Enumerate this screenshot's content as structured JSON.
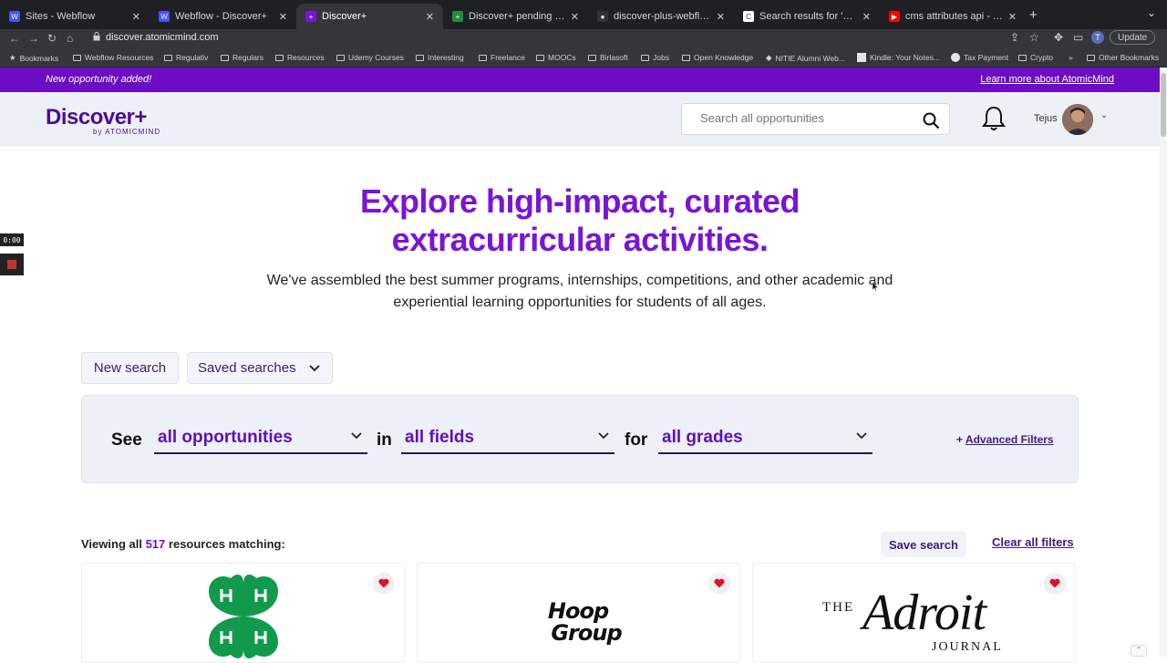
{
  "browser": {
    "tabs": [
      {
        "title": "Sites - Webflow",
        "favicon_color": "#4353ff",
        "favicon_letter": "W"
      },
      {
        "title": "Webflow - Discover+",
        "favicon_color": "#4353ff",
        "favicon_letter": "W"
      },
      {
        "title": "Discover+",
        "favicon_color": "#7a14d6",
        "favicon_letter": "+"
      },
      {
        "title": "Discover+ pending tasks for Te",
        "favicon_color": "#1e8e3e",
        "favicon_letter": "+"
      },
      {
        "title": "discover-plus-webflow/src/ind",
        "favicon_color": "#333333",
        "favicon_letter": "●"
      },
      {
        "title": "Search results for 'cms api' - S",
        "favicon_color": "#ffffff",
        "favicon_letter": "C"
      },
      {
        "title": "cms attributes api - YouTube",
        "favicon_color": "#ff0000",
        "favicon_letter": "▶"
      }
    ],
    "url": "discover.atomicmind.com",
    "profile_initial": "T",
    "update_label": "Update",
    "bookmarks": [
      "Bookmarks",
      "Webflow Resources",
      "Regulativ",
      "Regulars",
      "Resources",
      "Udemy Courses",
      "Interesting",
      "Freelance",
      "MOOCs",
      "Birlasoft",
      "Jobs",
      "Open Knowledge",
      "NITIE Alumni Web...",
      "Kindle: Your Notes...",
      "Tax Payment",
      "Crypto",
      "Other Bookmarks"
    ]
  },
  "announcement": {
    "left": "New opportunity added!",
    "right": "Learn more about AtomicMind"
  },
  "header": {
    "logo": "Discover+",
    "logo_sub": "by ATOMICMIND",
    "search_placeholder": "Search all opportunities",
    "user_name": "Tejus"
  },
  "recorder": {
    "time": "0:00"
  },
  "hero": {
    "title_line1": "Explore high-impact, curated",
    "title_line2": "extracurricular activities.",
    "subtitle_line1": "We've assembled the best summer programs, internships, competitions, and other academic and",
    "subtitle_line2": "experiential learning opportunities for students of all ages."
  },
  "actions": {
    "new_search": "New search",
    "saved_searches": "Saved searches"
  },
  "filters": {
    "see_label": "See",
    "in_label": "in",
    "for_label": "for",
    "type_value": "all opportunities",
    "field_value": "all fields",
    "grade_value": "all grades",
    "advanced_prefix": "+",
    "advanced_label": "Advanced Filters"
  },
  "results": {
    "prefix": "Viewing all",
    "count": "517",
    "suffix": "resources matching:",
    "save_search": "Save search",
    "clear_filters": "Clear all filters"
  },
  "cards": [
    {
      "logo": "4-H clover",
      "favorite": true
    },
    {
      "logo": "Hoop Group",
      "favorite": true
    },
    {
      "logo": "The Adroit Journal",
      "favorite": true
    }
  ],
  "card_logo_text": {
    "hoop_line1": "Hoop",
    "hoop_line2": "Group",
    "adroit_the": "THE",
    "adroit_main": "Adroit",
    "adroit_journal": "JOURNAL"
  },
  "colors": {
    "brand_purple": "#6c0cc4",
    "hero_purple": "#7a14d6",
    "heart_red": "#e0102a",
    "clover_green": "#119a4b"
  }
}
